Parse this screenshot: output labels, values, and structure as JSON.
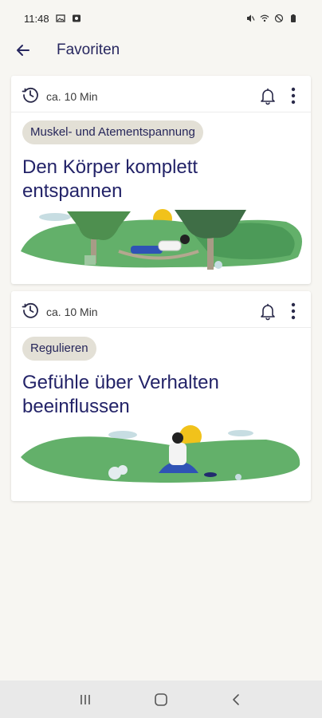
{
  "status_bar": {
    "time": "11:48"
  },
  "app_bar": {
    "title": "Favoriten",
    "back_icon": "arrow-left-icon"
  },
  "cards": [
    {
      "duration": "ca. 10 Min",
      "category": "Muskel- und Atementspannung",
      "title_line1": "Den Körper komplett",
      "title_line2": "entspannen"
    },
    {
      "duration": "ca. 10 Min",
      "category": "Regulieren",
      "title_line1": "Gefühle über Verhalten",
      "title_line2": "beeinflussen"
    }
  ],
  "colors": {
    "background": "#f7f6f2",
    "title": "#232368",
    "chip": "#e3e0d6",
    "hill_green": "#63b06a",
    "sun": "#f1c21b"
  },
  "nav_bar": {
    "icons": [
      "recent-apps-icon",
      "home-icon",
      "back-icon"
    ]
  }
}
